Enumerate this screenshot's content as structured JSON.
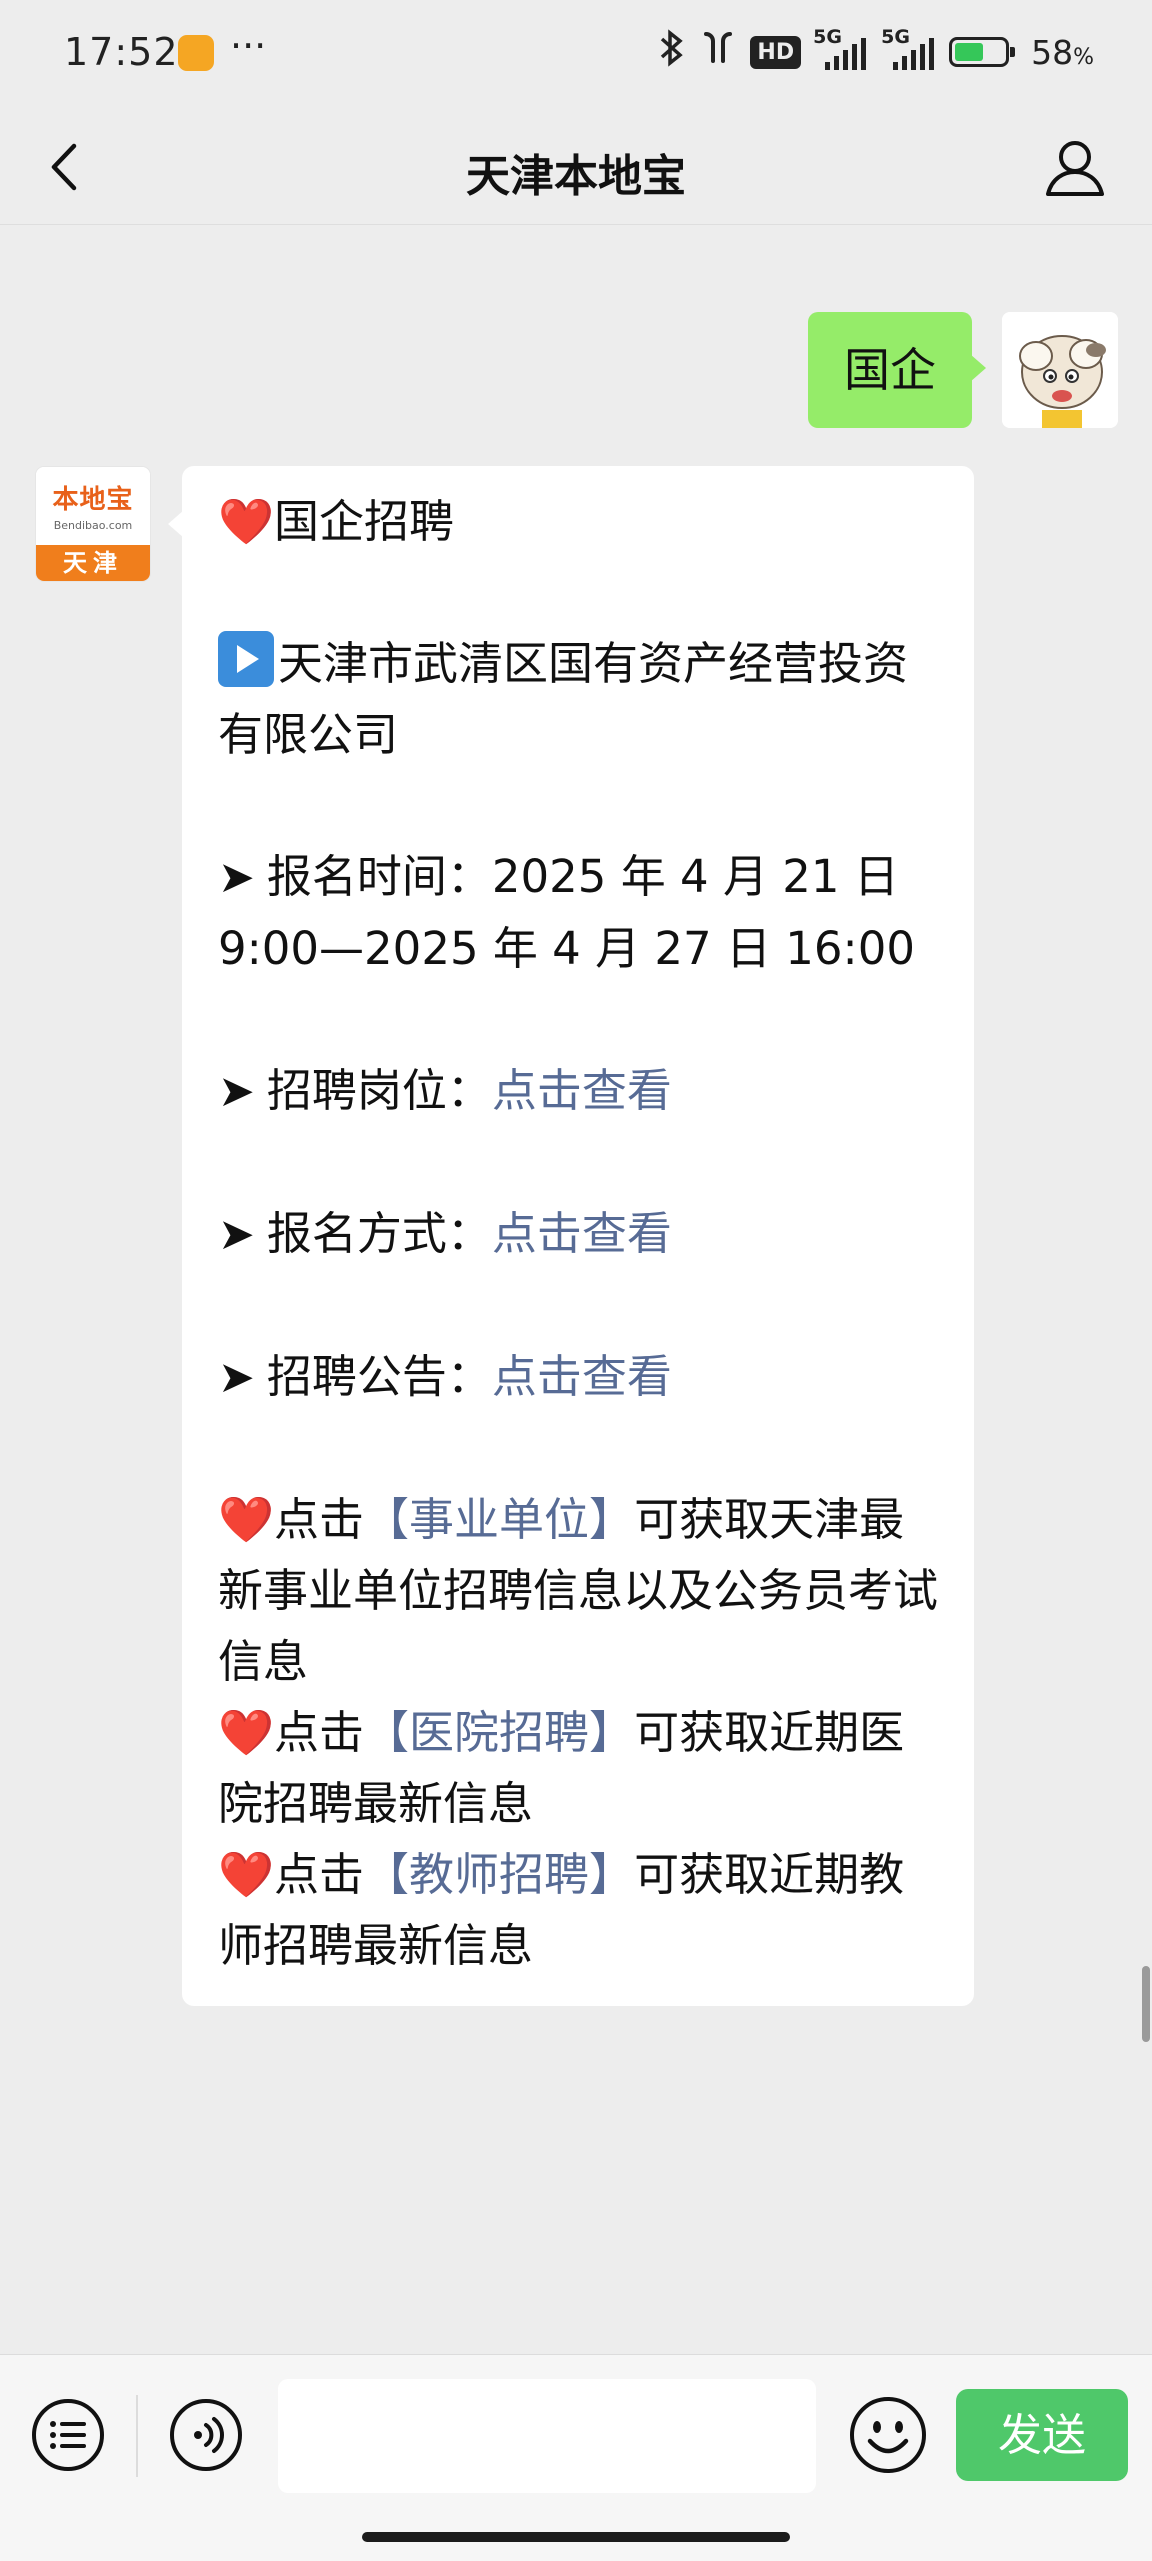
{
  "status_bar": {
    "time": "17:52",
    "more": "···",
    "hd": "HD",
    "network_1": "5G",
    "network_2": "5G",
    "battery_percent": "58",
    "battery_suffix": "%",
    "battery_level": 0.58,
    "battery_color": "#35c759"
  },
  "nav": {
    "title": "天津本地宝",
    "back_icon": "chevron-left-icon",
    "profile_icon": "person-icon"
  },
  "chat": {
    "outgoing": {
      "text": "国企",
      "bubble_color": "#95ec69"
    },
    "official_avatar": {
      "brand": "本地宝",
      "domain": "Bendibao.com",
      "city": "天津",
      "accent": "#f07e1c"
    },
    "incoming": {
      "heading": "国企招聘",
      "company": "天津市武清区国有资产经营投资有限公司",
      "reg_time_label": "报名时间：",
      "reg_time_value": "2025 年 4 月 21 日 9:00—2025 年 4 月 27 日 16:00",
      "positions_label": "招聘岗位：",
      "method_label": "报名方式：",
      "notice_label": "招聘公告：",
      "link_text": "点击查看",
      "tip_prefix": "点击",
      "tip1_link": "【事业单位】",
      "tip1_text": "可获取天津最新事业单位招聘信息以及公务员考试信息",
      "tip2_link": "【医院招聘】",
      "tip2_text": "可获取近期医院招聘最新信息",
      "tip3_link": "【教师招聘】",
      "tip3_text": "可获取近期教师招聘最新信息",
      "link_color": "#576b95",
      "heart_color": "#e0151b"
    }
  },
  "input_bar": {
    "menu_icon": "list-menu-icon",
    "voice_icon": "voice-icon",
    "input_value": "",
    "emoji_icon": "emoji-icon",
    "send_label": "发送",
    "send_color": "#4fc86a"
  }
}
